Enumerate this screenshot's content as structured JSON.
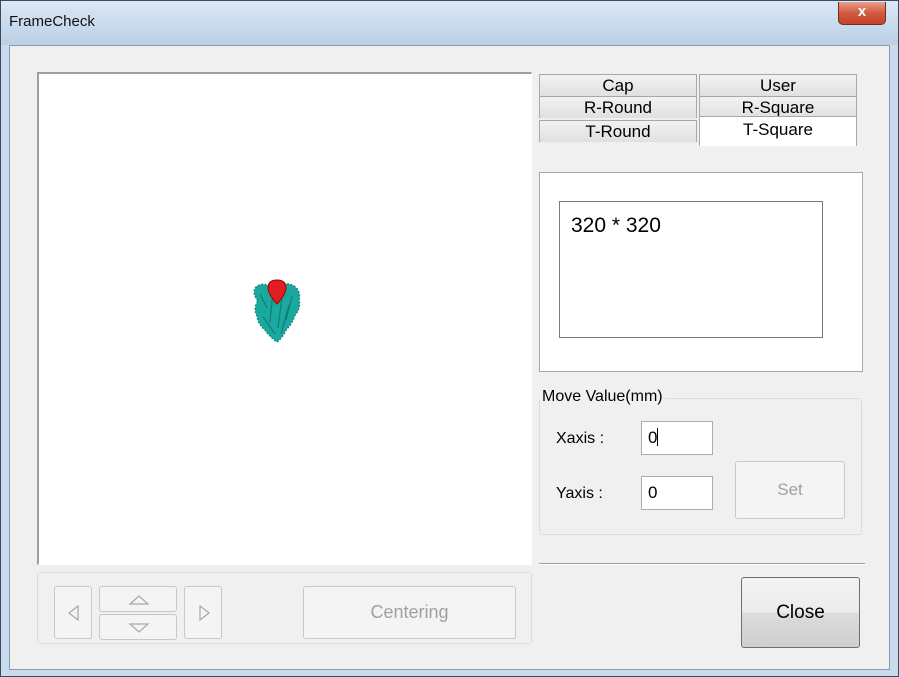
{
  "window": {
    "title": "FrameCheck",
    "close_glyph": "x"
  },
  "tabs": [
    {
      "label": "Cap",
      "active": false
    },
    {
      "label": "User",
      "active": false
    },
    {
      "label": "R-Round",
      "active": false
    },
    {
      "label": "R-Square",
      "active": false
    },
    {
      "label": "T-Round",
      "active": false
    },
    {
      "label": "T-Square",
      "active": true
    }
  ],
  "frame_list": {
    "items": [
      "320 * 320"
    ]
  },
  "move_value": {
    "group_label": "Move Value(mm)",
    "x_label": "Xaxis :",
    "x_value": "0",
    "y_label": "Yaxis :",
    "y_value": "0",
    "set_label": "Set"
  },
  "nav": {
    "left_icon": "triangle-left-icon",
    "up_icon": "triangle-up-icon",
    "down_icon": "triangle-down-icon",
    "right_icon": "triangle-right-icon",
    "centering_label": "Centering"
  },
  "close_label": "Close",
  "colors": {
    "design_fill": "#1aa89f",
    "marker": "#e02020"
  }
}
